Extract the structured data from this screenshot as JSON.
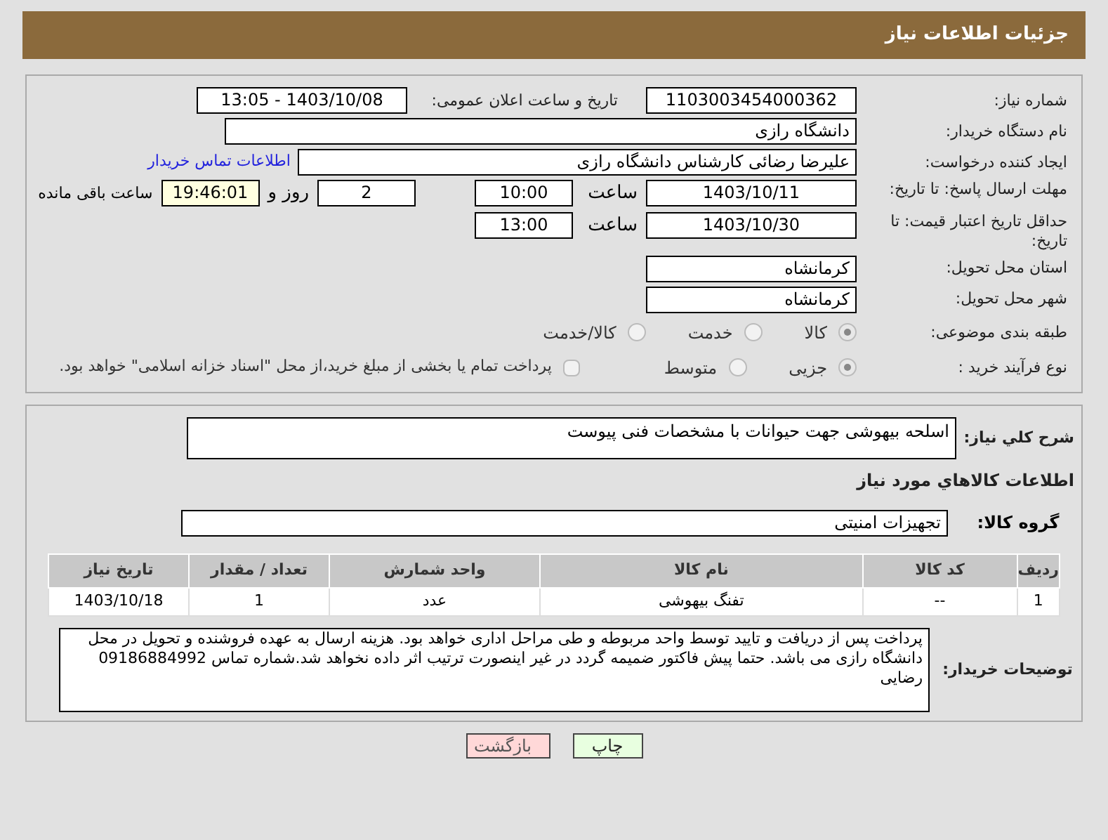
{
  "header": {
    "title": "جزئیات اطلاعات نیاز"
  },
  "need_number": {
    "label": "شماره نیاز:",
    "value": "1103003454000362"
  },
  "announce": {
    "label": "تاریخ و ساعت اعلان عمومی:",
    "value": "1403/10/08 - 13:05"
  },
  "buyer_org": {
    "label": "نام دستگاه خریدار:",
    "value": "دانشگاه رازی"
  },
  "requester": {
    "label": "ایجاد کننده درخواست:",
    "value": "علیرضا رضائی کارشناس دانشگاه رازی",
    "link": "اطلاعات تماس خریدار"
  },
  "reply_deadline": {
    "label": "مهلت ارسال پاسخ: تا تاریخ:",
    "date": "1403/10/11",
    "time_label": "ساعت",
    "time": "10:00",
    "days": "2",
    "days_label": "روز و",
    "remaining": "19:46:01",
    "remaining_label": "ساعت باقی مانده"
  },
  "price_validity": {
    "label": "حداقل تاریخ اعتبار قیمت: تا تاریخ:",
    "date": "1403/10/30",
    "time_label": "ساعت",
    "time": "13:00"
  },
  "province": {
    "label": "استان محل تحویل:",
    "value": "کرمانشاه"
  },
  "city": {
    "label": "شهر محل تحویل:",
    "value": "کرمانشاه"
  },
  "category": {
    "label": "طبقه بندی موضوعی:",
    "options": [
      {
        "label": "کالا",
        "selected": true
      },
      {
        "label": "خدمت",
        "selected": false
      },
      {
        "label": "کالا/خدمت",
        "selected": false
      }
    ]
  },
  "process": {
    "label": "نوع فرآیند خرید :",
    "options": [
      {
        "label": "جزیی",
        "selected": true
      },
      {
        "label": "متوسط",
        "selected": false
      }
    ],
    "treasury": {
      "checked": false,
      "text": "پرداخت تمام یا بخشی از مبلغ خرید،از محل \"اسناد خزانه اسلامی\" خواهد بود."
    }
  },
  "description": {
    "label": "شرح کلي نياز:",
    "value": "اسلحه بیهوشی جهت حیوانات با مشخصات فنی پیوست"
  },
  "goods_title": "اطلاعات کالاهاي مورد نياز",
  "goods_group": {
    "label": "گروه کالا:",
    "value": "تجهیزات امنیتی"
  },
  "table": {
    "columns": [
      "رديف",
      "کد کالا",
      "نام کالا",
      "واحد شمارش",
      "تعداد / مقدار",
      "تاريخ نياز"
    ],
    "rows": [
      [
        "1",
        "--",
        "تفنگ بیهوشی",
        "عدد",
        "1",
        "1403/10/18"
      ]
    ]
  },
  "buyer_notes": {
    "label": "توضیحات خریدار:",
    "value": "پرداخت پس از دریافت و تایید  توسط واحد مربوطه و طی مراحل اداری خواهد بود. هزینه ارسال به عهده فروشنده و تحویل در محل دانشگاه رازی می باشد. حتما پیش فاکتور ضمیمه گردد در غیر اینصورت ترتیب اثر داده نخواهد شد.شماره تماس 09186884992  رضایی"
  },
  "buttons": [
    {
      "label": "چاپ",
      "kind": "print"
    },
    {
      "label": "بازگشت",
      "kind": "back"
    }
  ]
}
